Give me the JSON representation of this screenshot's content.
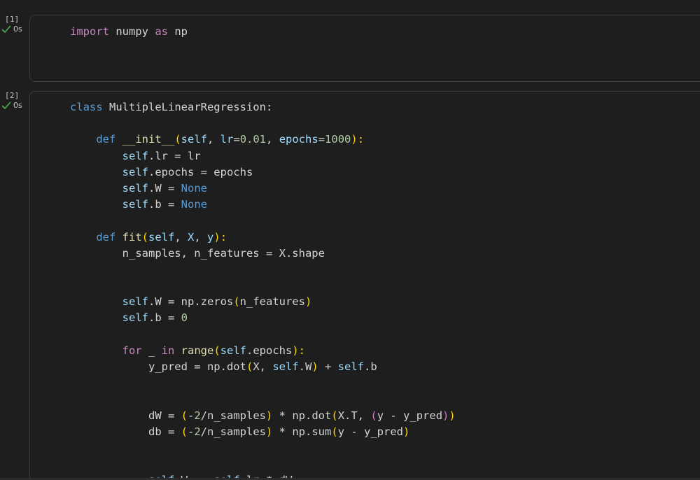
{
  "cells": [
    {
      "exec_count": "[1]",
      "exec_time": "0s",
      "status": "success",
      "lines": [
        [
          [
            "import",
            "kw-purple"
          ],
          [
            " numpy ",
            "txt"
          ],
          [
            "as",
            "kw-purple"
          ],
          [
            " np",
            "txt"
          ]
        ]
      ]
    },
    {
      "exec_count": "[2]",
      "exec_time": "0s",
      "status": "success",
      "lines": [
        [
          [
            "class",
            "kw-blue"
          ],
          [
            " MultipleLinearRegression:",
            "txt"
          ]
        ],
        [],
        [
          [
            "    ",
            "txt"
          ],
          [
            "def",
            "kw-blue"
          ],
          [
            " ",
            "txt"
          ],
          [
            "__init__",
            "fn"
          ],
          [
            "(",
            "p1"
          ],
          [
            "self",
            "var"
          ],
          [
            ", ",
            "txt"
          ],
          [
            "lr",
            "var"
          ],
          [
            "=",
            "txt"
          ],
          [
            "0.01",
            "num"
          ],
          [
            ", ",
            "txt"
          ],
          [
            "epochs",
            "var"
          ],
          [
            "=",
            "txt"
          ],
          [
            "1000",
            "num"
          ],
          [
            "):",
            "p1"
          ]
        ],
        [
          [
            "        ",
            "txt"
          ],
          [
            "self",
            "var"
          ],
          [
            ".lr = lr",
            "txt"
          ]
        ],
        [
          [
            "        ",
            "txt"
          ],
          [
            "self",
            "var"
          ],
          [
            ".epochs = epochs",
            "txt"
          ]
        ],
        [
          [
            "        ",
            "txt"
          ],
          [
            "self",
            "var"
          ],
          [
            ".W = ",
            "txt"
          ],
          [
            "None",
            "kw-blue"
          ]
        ],
        [
          [
            "        ",
            "txt"
          ],
          [
            "self",
            "var"
          ],
          [
            ".b = ",
            "txt"
          ],
          [
            "None",
            "kw-blue"
          ]
        ],
        [],
        [
          [
            "    ",
            "txt"
          ],
          [
            "def",
            "kw-blue"
          ],
          [
            " ",
            "txt"
          ],
          [
            "fit",
            "fn"
          ],
          [
            "(",
            "p1"
          ],
          [
            "self",
            "var"
          ],
          [
            ", ",
            "txt"
          ],
          [
            "X",
            "var"
          ],
          [
            ", ",
            "txt"
          ],
          [
            "y",
            "var"
          ],
          [
            "):",
            "p1"
          ]
        ],
        [
          [
            "        n_samples, n_features = X.shape",
            "txt"
          ]
        ],
        [],
        [],
        [
          [
            "        ",
            "txt"
          ],
          [
            "self",
            "var"
          ],
          [
            ".W = np.zeros",
            "txt"
          ],
          [
            "(",
            "p1"
          ],
          [
            "n_features",
            "txt"
          ],
          [
            ")",
            "p1"
          ]
        ],
        [
          [
            "        ",
            "txt"
          ],
          [
            "self",
            "var"
          ],
          [
            ".b = ",
            "txt"
          ],
          [
            "0",
            "num"
          ]
        ],
        [],
        [
          [
            "        ",
            "txt"
          ],
          [
            "for",
            "kw-purple"
          ],
          [
            " _ ",
            "txt"
          ],
          [
            "in",
            "kw-purple"
          ],
          [
            " ",
            "txt"
          ],
          [
            "range",
            "fn"
          ],
          [
            "(",
            "p1"
          ],
          [
            "self",
            "var"
          ],
          [
            ".epochs",
            "txt"
          ],
          [
            "):",
            "p1"
          ]
        ],
        [
          [
            "            y_pred = np.dot",
            "txt"
          ],
          [
            "(",
            "p1"
          ],
          [
            "X, ",
            "txt"
          ],
          [
            "self",
            "var"
          ],
          [
            ".W",
            "txt"
          ],
          [
            ")",
            "p1"
          ],
          [
            " + ",
            "txt"
          ],
          [
            "self",
            "var"
          ],
          [
            ".b",
            "txt"
          ]
        ],
        [],
        [],
        [
          [
            "            dW = ",
            "txt"
          ],
          [
            "(",
            "p1"
          ],
          [
            "-",
            "txt"
          ],
          [
            "2",
            "num"
          ],
          [
            "/n_samples",
            "txt"
          ],
          [
            ")",
            "p1"
          ],
          [
            " * np.dot",
            "txt"
          ],
          [
            "(",
            "p1"
          ],
          [
            "X.T, ",
            "txt"
          ],
          [
            "(",
            "p2"
          ],
          [
            "y - y_pred",
            "txt"
          ],
          [
            ")",
            "p2"
          ],
          [
            ")",
            "p1"
          ]
        ],
        [
          [
            "            db = ",
            "txt"
          ],
          [
            "(",
            "p1"
          ],
          [
            "-",
            "txt"
          ],
          [
            "2",
            "num"
          ],
          [
            "/n_samples",
            "txt"
          ],
          [
            ")",
            "p1"
          ],
          [
            " * np.sum",
            "txt"
          ],
          [
            "(",
            "p1"
          ],
          [
            "y - y_pred",
            "txt"
          ],
          [
            ")",
            "p1"
          ]
        ],
        [],
        [],
        [
          [
            "            ",
            "txt"
          ],
          [
            "self",
            "var"
          ],
          [
            ".W -= ",
            "txt"
          ],
          [
            "self",
            "var"
          ],
          [
            ".lr * dW",
            "txt"
          ]
        ]
      ]
    }
  ]
}
